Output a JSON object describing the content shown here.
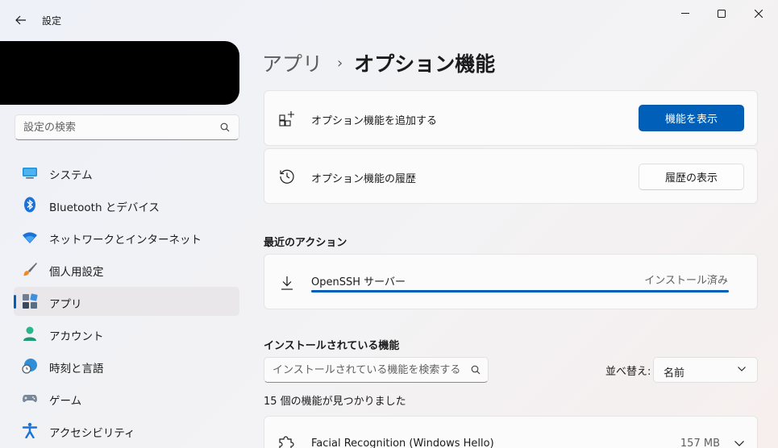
{
  "window": {
    "title": "設定"
  },
  "sidebar": {
    "search_placeholder": "設定の検索",
    "items": [
      {
        "label": "システム",
        "icon": "monitor-icon"
      },
      {
        "label": "Bluetooth とデバイス",
        "icon": "bluetooth-icon"
      },
      {
        "label": "ネットワークとインターネット",
        "icon": "wifi-icon"
      },
      {
        "label": "個人用設定",
        "icon": "paintbrush-icon"
      },
      {
        "label": "アプリ",
        "icon": "apps-icon",
        "active": true
      },
      {
        "label": "アカウント",
        "icon": "person-icon"
      },
      {
        "label": "時刻と言語",
        "icon": "globe-clock-icon"
      },
      {
        "label": "ゲーム",
        "icon": "gamepad-icon"
      },
      {
        "label": "アクセシビリティ",
        "icon": "accessibility-icon"
      }
    ]
  },
  "breadcrumb": {
    "parent": "アプリ",
    "separator": "›",
    "current": "オプション機能"
  },
  "add_feature": {
    "label": "オプション機能を追加する",
    "button": "機能を表示"
  },
  "history": {
    "label": "オプション機能の履歴",
    "button": "履歴の表示"
  },
  "recent_actions": {
    "title": "最近のアクション",
    "item": {
      "name": "OpenSSH サーバー",
      "status": "インストール済み",
      "progress": 1.0
    }
  },
  "installed": {
    "title": "インストールされている機能",
    "search_placeholder": "インストールされている機能を検索する",
    "sort_label": "並べ替え:",
    "sort_value": "名前",
    "count_text": "15 個の機能が見つかりました",
    "features": [
      {
        "name": "Facial Recognition (Windows Hello)",
        "size": "157 MB"
      }
    ]
  },
  "colors": {
    "accent": "#005fb8"
  }
}
